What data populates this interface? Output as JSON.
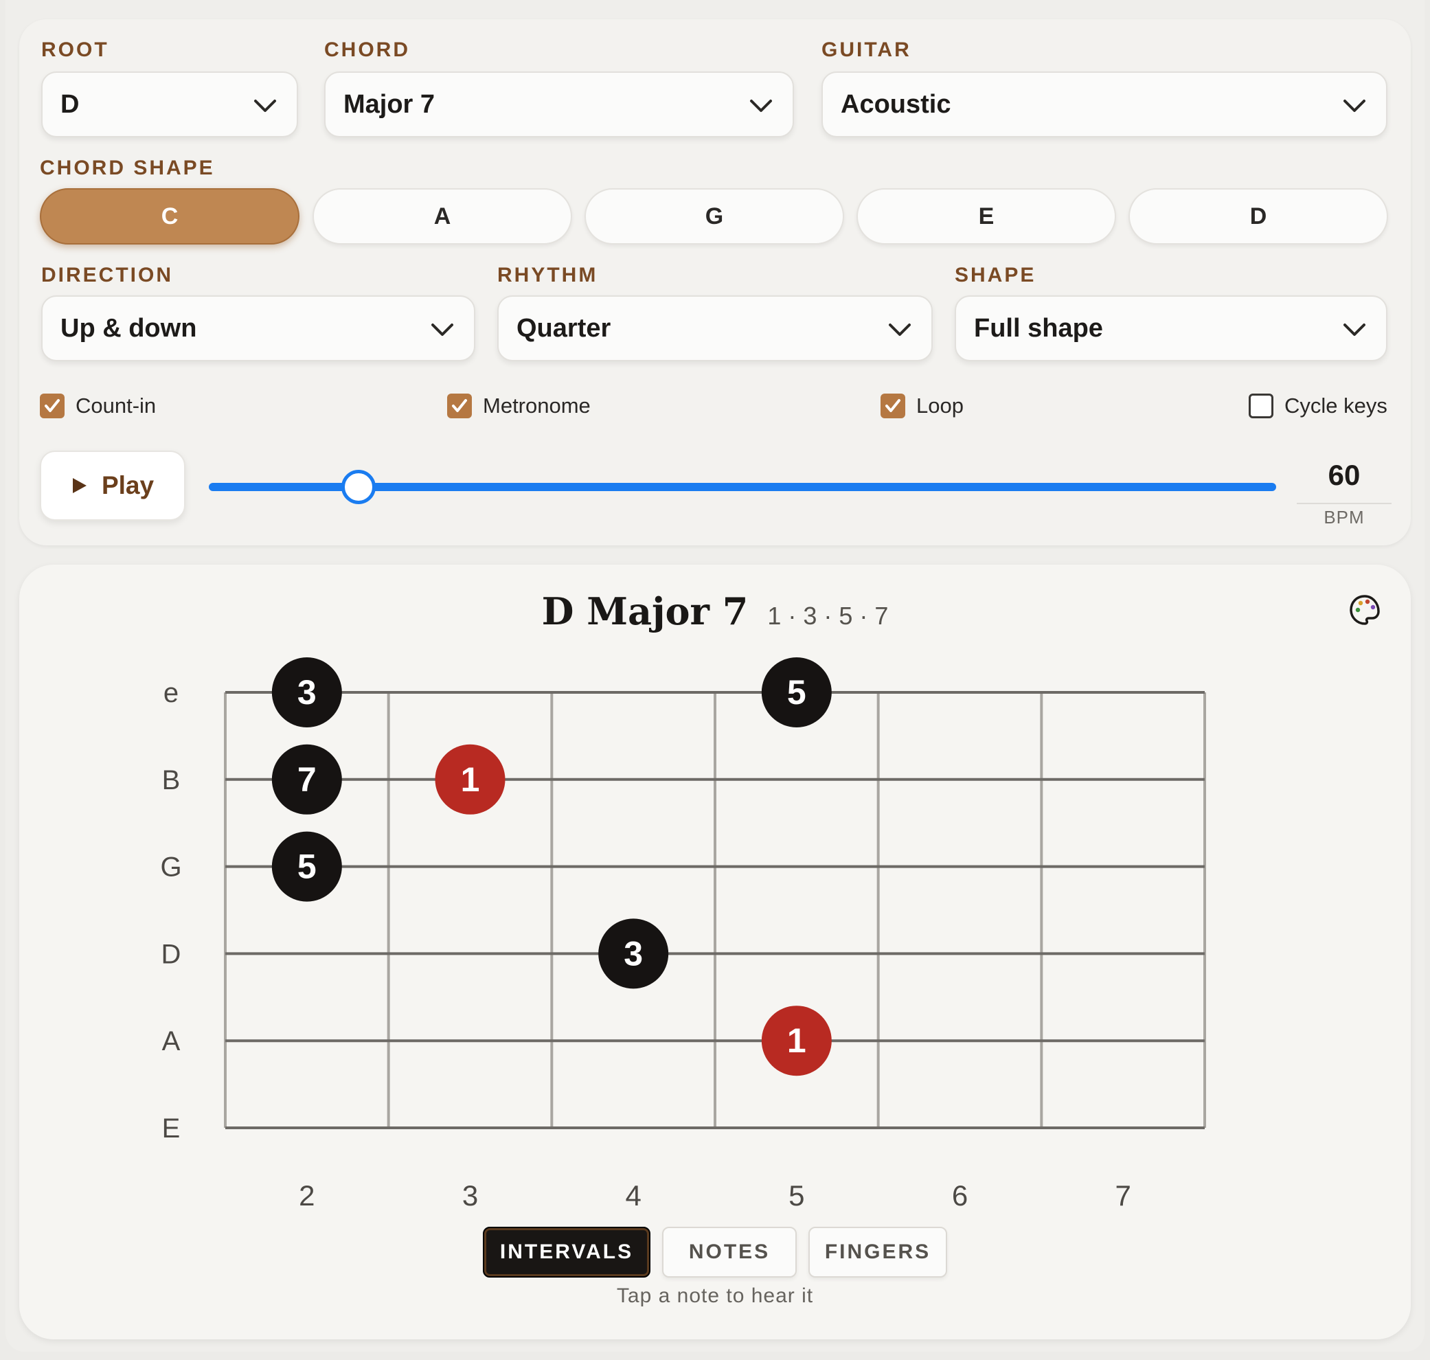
{
  "controls": {
    "root": {
      "label": "ROOT",
      "value": "D"
    },
    "chord": {
      "label": "CHORD",
      "value": "Major 7"
    },
    "guitar": {
      "label": "GUITAR",
      "value": "Acoustic"
    },
    "chord_shape": {
      "label": "CHORD SHAPE",
      "options": [
        "C",
        "A",
        "G",
        "E",
        "D"
      ],
      "selected": "C"
    },
    "direction": {
      "label": "DIRECTION",
      "value": "Up & down"
    },
    "rhythm": {
      "label": "RHYTHM",
      "value": "Quarter"
    },
    "shape": {
      "label": "SHAPE",
      "value": "Full shape"
    },
    "checkboxes": [
      {
        "label": "Count-in",
        "checked": true
      },
      {
        "label": "Metronome",
        "checked": true
      },
      {
        "label": "Loop",
        "checked": true
      },
      {
        "label": "Cycle keys",
        "checked": false
      }
    ],
    "play_label": "Play",
    "tempo": {
      "value": "60",
      "unit": "BPM",
      "slider_fraction": 0.14
    },
    "accent_color": "#bf8752",
    "slider_color": "#1a7cf0"
  },
  "fretboard": {
    "chord_name": "D Major 7",
    "formula": "1 · 3 · 5 · 7",
    "strings": [
      "e",
      "B",
      "G",
      "D",
      "A",
      "E"
    ],
    "frets": [
      "2",
      "3",
      "4",
      "5",
      "6",
      "7"
    ],
    "notes": [
      {
        "string": "e",
        "fret": 2,
        "label": "3",
        "root": false
      },
      {
        "string": "e",
        "fret": 5,
        "label": "5",
        "root": false
      },
      {
        "string": "B",
        "fret": 2,
        "label": "7",
        "root": false
      },
      {
        "string": "B",
        "fret": 3,
        "label": "1",
        "root": true
      },
      {
        "string": "G",
        "fret": 2,
        "label": "5",
        "root": false
      },
      {
        "string": "D",
        "fret": 4,
        "label": "3",
        "root": false
      },
      {
        "string": "A",
        "fret": 5,
        "label": "1",
        "root": true
      }
    ],
    "root_color": "#b82a22",
    "note_color": "#161312",
    "view_tabs": [
      "INTERVALS",
      "NOTES",
      "FINGERS"
    ],
    "active_tab": "INTERVALS",
    "hint": "Tap a note to hear it"
  },
  "icons": {
    "palette": "palette-icon",
    "dropdown": "chevron-down-icon",
    "play": "play-icon",
    "check": "check-icon"
  }
}
